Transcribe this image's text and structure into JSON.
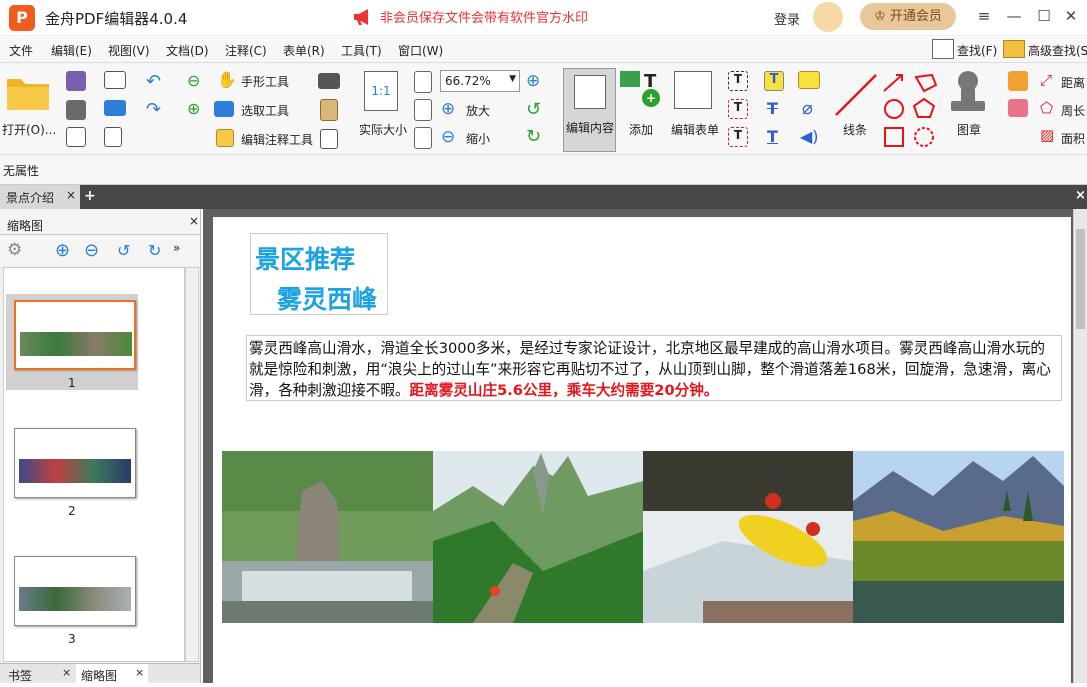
{
  "titlebar": {
    "logo_letter": "P",
    "app_title": "金舟PDF编辑器4.0.4",
    "notice": "非会员保存文件会带有软件官方水印",
    "login": "登录",
    "vip_button": "开通会员"
  },
  "menu": [
    "文件",
    "编辑(E)",
    "视图(V)",
    "文档(D)",
    "注释(C)",
    "表单(R)",
    "工具(T)",
    "窗口(W)"
  ],
  "search": {
    "find": "查找(F)",
    "advanced_find": "高级查找(S"
  },
  "toolbar": {
    "open": "打开(O)...",
    "hand_tool": "手形工具",
    "select_tool": "选取工具",
    "edit_annotation_tool": "编辑注释工具",
    "actual_size": "实际大小",
    "zoom_value": "66.72%",
    "zoom_in": "放大",
    "zoom_out": "缩小",
    "edit_content": "编辑内容",
    "add": "添加",
    "edit_form": "编辑表单",
    "line": "线条",
    "stamp": "图章",
    "distance": "距离",
    "perimeter": "周长",
    "area": "面积"
  },
  "properties": {
    "text": "无属性"
  },
  "tabs": {
    "document": "景点介绍",
    "add_symbol": "+",
    "close_symbol": "×"
  },
  "panel": {
    "title": "缩略图",
    "pages": [
      "1",
      "2",
      "3"
    ],
    "bottom_tabs": [
      "书签",
      "缩略图"
    ]
  },
  "document": {
    "heading1": "景区推荐",
    "heading2": "雾灵西峰",
    "paragraph": "雾灵西峰高山滑水，滑道全长3000多米，是经过专家论证设计，北京地区最早建成的高山滑水项目。雾灵西峰高山滑水玩的就是惊险和刺激，用“浪尖上的过山车”来形容它再贴切不过了，从山顶到山脚，整个滑道落差168米，回旋滑，急速滑，离心滑，各种刺激迎接不暇。",
    "highlight": "距离雾灵山庄5.6公里，乘车大约需要20分钟。",
    "highlight_color": "#e8141c",
    "heading_color": "#1aa3e0"
  }
}
